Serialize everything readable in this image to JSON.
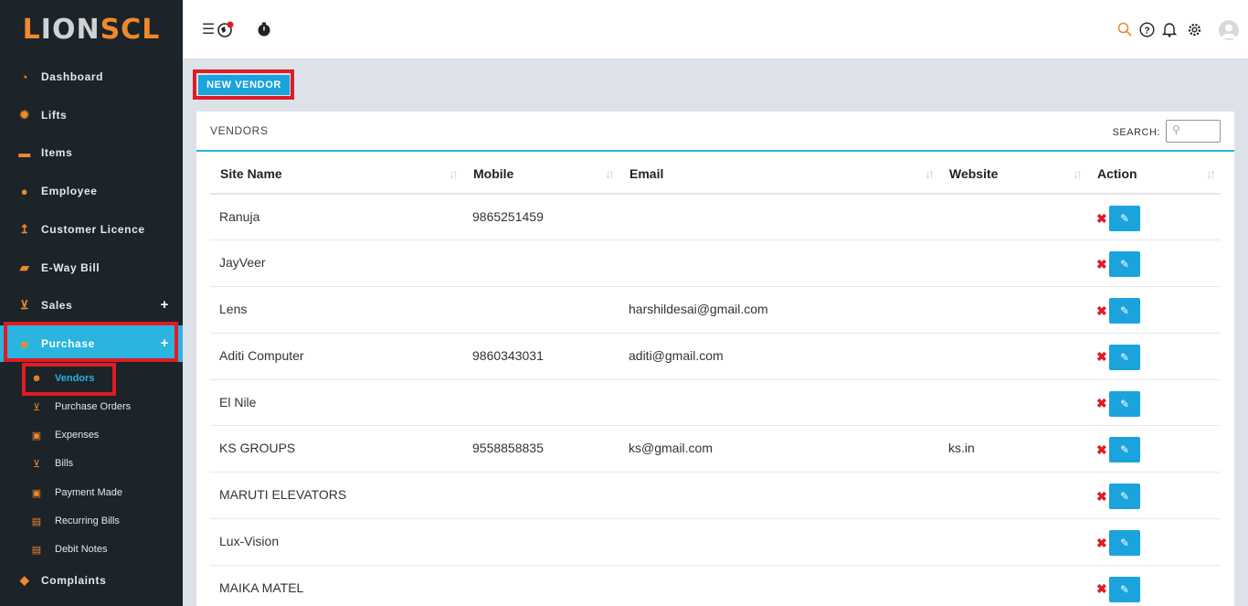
{
  "app": {
    "logo_prefix": "L",
    "logo_mid": "ION",
    "logo_suffix": "SCL"
  },
  "sidebar": {
    "items": [
      {
        "label": "Dashboard",
        "icon": "dashboard-icon"
      },
      {
        "label": "Lifts",
        "icon": "gear-icon"
      },
      {
        "label": "Items",
        "icon": "archive-icon"
      },
      {
        "label": "Employee",
        "icon": "user-icon"
      },
      {
        "label": "Customer Licence",
        "icon": "upload-icon"
      },
      {
        "label": "E-Way Bill",
        "icon": "truck-icon"
      },
      {
        "label": "Sales",
        "icon": "cart-icon",
        "expand": "+"
      },
      {
        "label": "Purchase",
        "icon": "briefcase-icon",
        "expand": "+"
      },
      {
        "label": "Complaints",
        "icon": "tag-icon"
      }
    ],
    "purchase_sub": [
      {
        "label": "Vendors",
        "icon": "users-icon"
      },
      {
        "label": "Purchase Orders",
        "icon": "cart-icon"
      },
      {
        "label": "Expenses",
        "icon": "money-icon"
      },
      {
        "label": "Bills",
        "icon": "cart-icon"
      },
      {
        "label": "Payment Made",
        "icon": "money-icon"
      },
      {
        "label": "Recurring Bills",
        "icon": "file-icon"
      },
      {
        "label": "Debit Notes",
        "icon": "file-icon"
      }
    ]
  },
  "toolbar": {
    "new_vendor_label": "NEW VENDOR"
  },
  "panel": {
    "title": "VENDORS",
    "search_label": "SEARCH:",
    "search_value": ""
  },
  "table": {
    "columns": [
      "Site Name",
      "Mobile",
      "Email",
      "Website",
      "Action"
    ],
    "rows": [
      {
        "site": "Ranuja",
        "mobile": "9865251459",
        "email": "",
        "website": ""
      },
      {
        "site": "JayVeer",
        "mobile": "",
        "email": "",
        "website": ""
      },
      {
        "site": "Lens",
        "mobile": "",
        "email": "harshildesai@gmail.com",
        "website": ""
      },
      {
        "site": "Aditi Computer",
        "mobile": "9860343031",
        "email": "aditi@gmail.com",
        "website": ""
      },
      {
        "site": "El Nile",
        "mobile": "",
        "email": "",
        "website": ""
      },
      {
        "site": "KS GROUPS",
        "mobile": "9558858835",
        "email": "ks@gmail.com",
        "website": "ks.in"
      },
      {
        "site": "MARUTI ELEVATORS",
        "mobile": "",
        "email": "",
        "website": ""
      },
      {
        "site": "Lux-Vision",
        "mobile": "",
        "email": "",
        "website": ""
      },
      {
        "site": "MAIKA MATEL",
        "mobile": "",
        "email": "",
        "website": ""
      }
    ]
  },
  "colors": {
    "accent": "#2ab4df",
    "brand_orange": "#f0892b",
    "sidebar_bg": "#1c2329",
    "highlight_red": "#e01b24"
  }
}
